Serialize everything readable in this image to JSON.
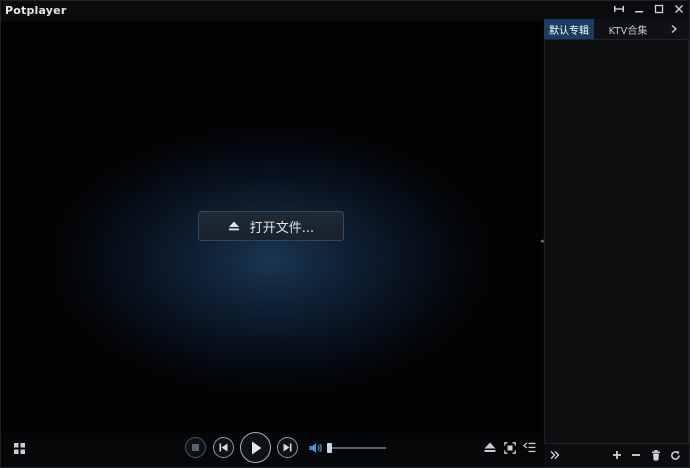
{
  "window": {
    "title": "Potplayer"
  },
  "title_buttons": [
    {
      "name": "pin-button",
      "icon": "pin-icon"
    },
    {
      "name": "minimize-button",
      "icon": "minimize-icon"
    },
    {
      "name": "maximize-button",
      "icon": "maximize-icon"
    },
    {
      "name": "close-button",
      "icon": "close-icon"
    }
  ],
  "video": {
    "open_file_label": "打开文件..."
  },
  "playlist": {
    "tabs": [
      {
        "label": "默认专辑",
        "active": true
      },
      {
        "label": "KTV合集",
        "active": false
      }
    ],
    "more_icon": "chevron-right-icon",
    "bottom_icons": [
      "double-chevron-right-icon",
      "add-icon",
      "remove-icon",
      "trash-icon",
      "refresh-icon"
    ]
  },
  "controls": {
    "left_icon": "grid-icon",
    "playback_icons": [
      "stop-icon",
      "previous-icon",
      "play-icon",
      "next-icon"
    ],
    "volume_icon": "speaker-icon",
    "volume_level": 0.05,
    "right_icons": [
      "eject-icon",
      "capture-icon",
      "playlist-toggle-icon"
    ]
  },
  "colors": {
    "accent_tab": "#1b3c63",
    "background": "#050608",
    "glow": "#1a3552"
  }
}
